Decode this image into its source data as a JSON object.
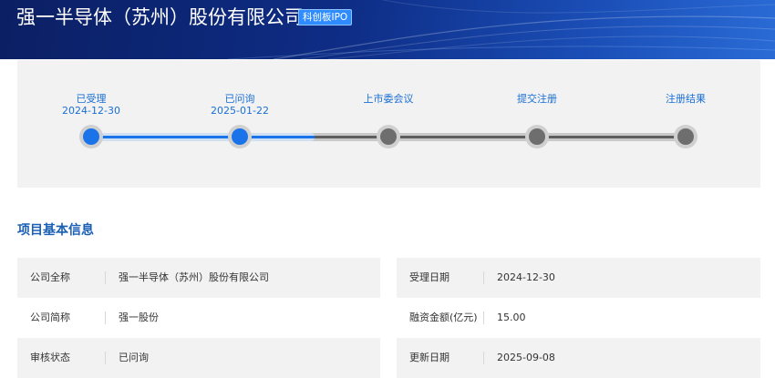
{
  "header": {
    "company_title": "强一半导体（苏州）股份有限公司",
    "board_badge": "科创板IPO"
  },
  "progress": {
    "current_step_index": 1,
    "steps": [
      {
        "label": "已受理",
        "date": "2024-12-30",
        "status": "done"
      },
      {
        "label": "已问询",
        "date": "2025-01-22",
        "status": "done"
      },
      {
        "label": "上市委会议",
        "date": "",
        "status": "pending"
      },
      {
        "label": "提交注册",
        "date": "",
        "status": "pending"
      },
      {
        "label": "注册结果",
        "date": "",
        "status": "pending"
      }
    ]
  },
  "basic_info": {
    "section_title": "项目基本信息",
    "left": [
      {
        "key": "公司全称",
        "value": "强一半导体（苏州）股份有限公司"
      },
      {
        "key": "公司简称",
        "value": "强一股份"
      },
      {
        "key": "审核状态",
        "value": "已问询"
      }
    ],
    "right": [
      {
        "key": "受理日期",
        "value": "2024-12-30"
      },
      {
        "key": "融资金额(亿元)",
        "value": "15.00"
      },
      {
        "key": "更新日期",
        "value": "2025-09-08"
      }
    ]
  },
  "colors": {
    "header_dark": "#0b1f63",
    "accent_blue": "#1a73e8",
    "section_title": "#1a5fb4",
    "panel_bg": "#f2f2f2"
  }
}
